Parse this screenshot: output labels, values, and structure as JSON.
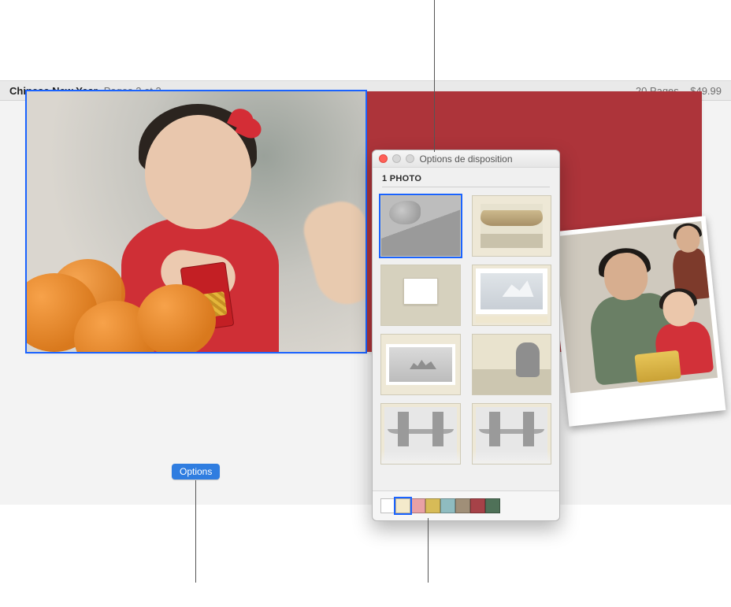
{
  "toolbar": {
    "project_title": "Chinese New Year",
    "page_indicator": "Pages 2 et 3",
    "summary": "20 Pages – $49.99"
  },
  "page_left": {
    "options_button_label": "Options"
  },
  "layout_panel": {
    "title": "Options de disposition",
    "section_label": "1 PHOTO",
    "selected_layout_index": 0,
    "colors": [
      "#ffffff",
      "#f4eacb",
      "#e9a1a5",
      "#d7bb57",
      "#8fbcc0",
      "#a08f78",
      "#a64248",
      "#4f7158"
    ],
    "selected_color_index": 1
  }
}
